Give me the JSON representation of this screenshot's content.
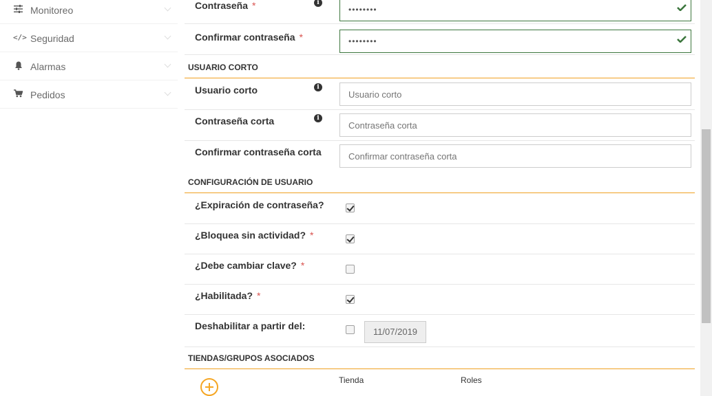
{
  "sidebar": {
    "items": [
      {
        "label": "Monitoreo",
        "icon": "sliders-icon"
      },
      {
        "label": "Seguridad",
        "icon": "code-icon"
      },
      {
        "label": "Alarmas",
        "icon": "bell-icon"
      },
      {
        "label": "Pedidos",
        "icon": "cart-icon"
      }
    ]
  },
  "form": {
    "password": {
      "label": "Contraseña",
      "value": "••••••••"
    },
    "confirm_password": {
      "label": "Confirmar contraseña",
      "value": "••••••••"
    },
    "required_mark": "*",
    "short_user_section": "USUARIO CORTO",
    "short_user": {
      "label": "Usuario corto",
      "placeholder": "Usuario corto"
    },
    "short_password": {
      "label": "Contraseña corta",
      "placeholder": "Contraseña corta"
    },
    "confirm_short_password": {
      "label": "Confirmar contraseña corta",
      "placeholder": "Confirmar contraseña corta"
    },
    "user_config_section": "CONFIGURACIÓN DE USUARIO",
    "password_expiration": {
      "label": "¿Expiración de contraseña?",
      "checked": true
    },
    "lock_inactivity": {
      "label": "¿Bloquea sin actividad?",
      "checked": true
    },
    "must_change_key": {
      "label": "¿Debe cambiar clave?",
      "checked": false
    },
    "enabled": {
      "label": "¿Habilitada?",
      "checked": true
    },
    "disable_from": {
      "label": "Deshabilitar a partir del:",
      "checked": false,
      "date": "11/07/2019"
    },
    "stores_section": "TIENDAS/GRUPOS ASOCIADOS",
    "table_headers": {
      "store": "Tienda",
      "roles": "Roles"
    }
  },
  "colors": {
    "accent": "#f5a623",
    "valid": "#3c763d",
    "required": "#d9534f"
  }
}
